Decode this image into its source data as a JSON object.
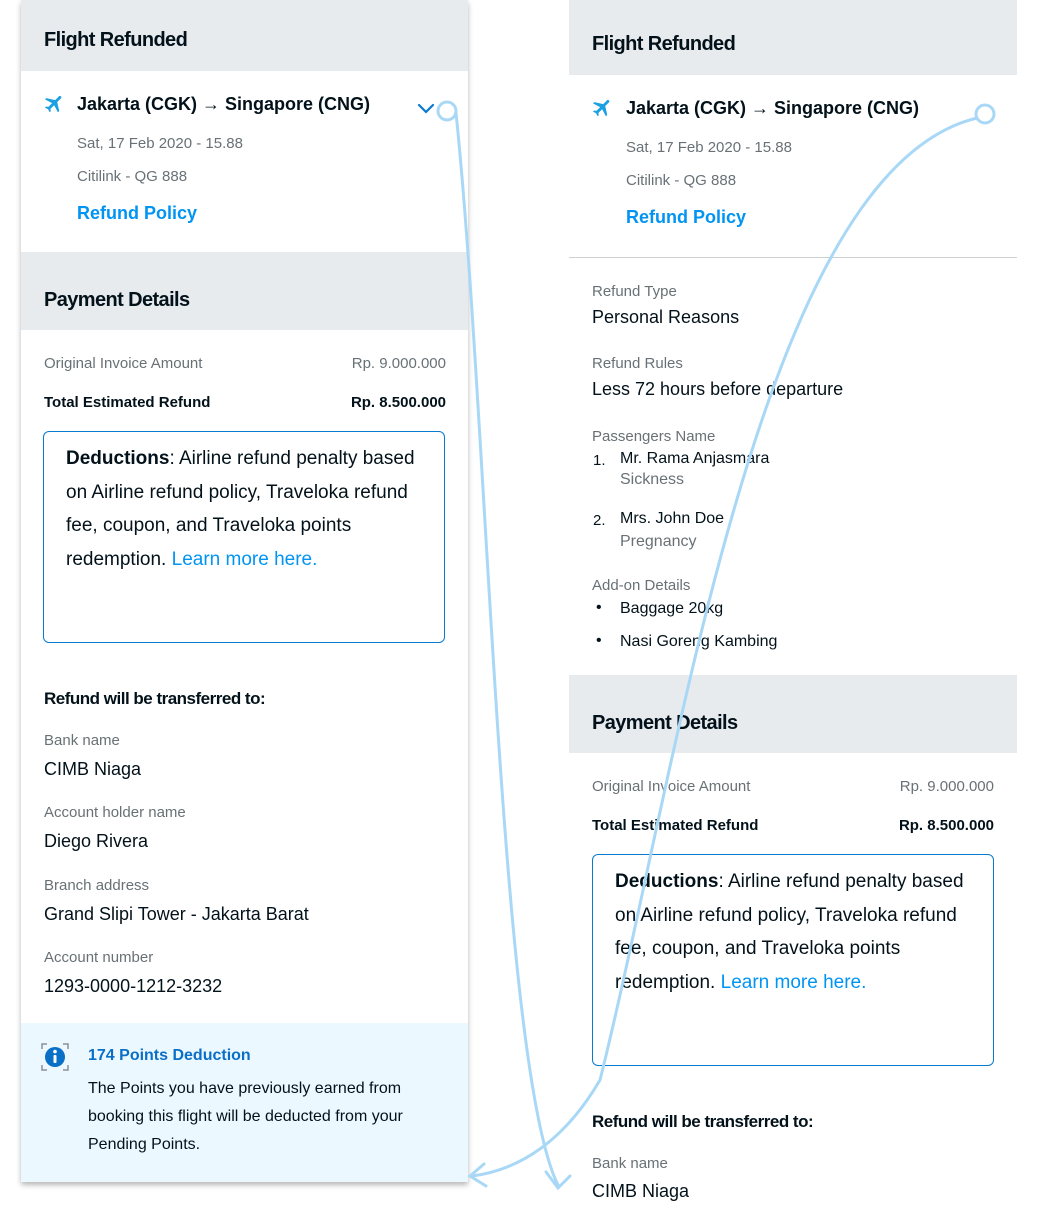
{
  "flight": {
    "section_title": "Flight Refunded",
    "route": "Jakarta (CGK) → Singapore (CNG)",
    "date": "Sat, 17 Feb 2020 - 15.88",
    "carrier": "Citilink - QG 888",
    "policy_link": "Refund Policy",
    "plane_icon": "plane-icon",
    "chevron_icon": "chevron-down-icon"
  },
  "details": {
    "refund_type_label": "Refund Type",
    "refund_type_value": "Personal Reasons",
    "refund_rules_label": "Refund Rules",
    "refund_rules_value": "Less 72 hours before departure",
    "passengers_label": "Passengers Name",
    "passengers": [
      {
        "num": "1.",
        "name": "Mr. Rama Anjasmara",
        "reason": "Sickness"
      },
      {
        "num": "2.",
        "name": "Mrs. John Doe",
        "reason": "Pregnancy"
      }
    ],
    "addon_label": "Add-on Details",
    "addons": [
      "Baggage 20kg",
      "Nasi Goreng Kambing"
    ]
  },
  "payment": {
    "section_title": "Payment Details",
    "original_label": "Original Invoice Amount",
    "original_value": "Rp. 9.000.000",
    "total_label": "Total Estimated Refund",
    "total_value": "Rp. 8.500.000",
    "deductions_title": "Deductions",
    "deductions_text": ": Airline refund penalty based on Airline refund policy, Traveloka refund fee, coupon, and Traveloka points redemption. ",
    "deductions_link": "Learn more here."
  },
  "transfer": {
    "heading": "Refund will be transferred to:",
    "bank_label": "Bank name",
    "bank_value": "CIMB Niaga",
    "holder_label": "Account holder name",
    "holder_value": "Diego Rivera",
    "branch_label": "Branch address",
    "branch_value": "Grand Slipi Tower - Jakarta Barat",
    "account_label": "Account number",
    "account_value": "1293-0000-1212-3232"
  },
  "points": {
    "title": "174 Points Deduction",
    "body": "The Points you have previously earned from booking this flight will be deducted from your Pending Points.",
    "icon": "info-icon"
  },
  "colors": {
    "accent": "#0194f3",
    "header_bg": "#e8ebee",
    "info_bg": "#ecf8ff",
    "box_border": "#0a7ad1",
    "flow_line": "#a9d8f7"
  }
}
